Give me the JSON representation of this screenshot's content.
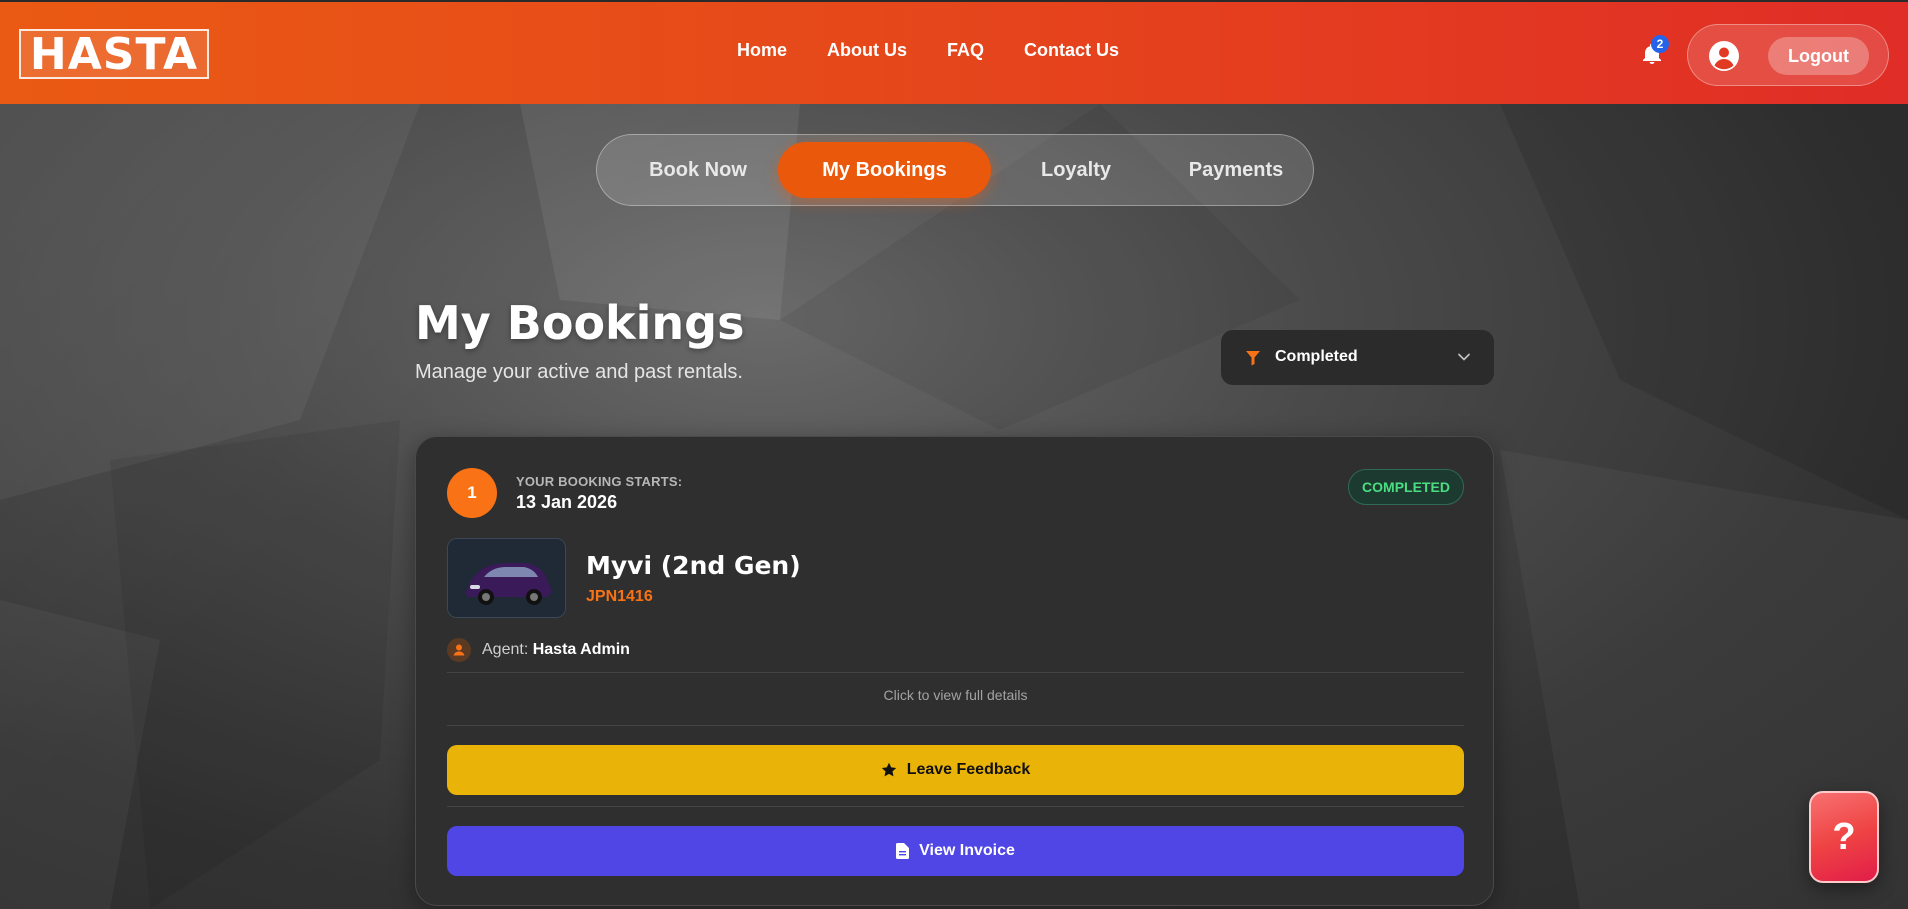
{
  "header": {
    "logo_text": "HASTA",
    "nav": [
      "Home",
      "About Us",
      "FAQ",
      "Contact Us"
    ],
    "notification_count": "2",
    "logout_label": "Logout"
  },
  "tabs": [
    {
      "label": "Book Now",
      "active": false
    },
    {
      "label": "My Bookings",
      "active": true
    },
    {
      "label": "Loyalty",
      "active": false
    },
    {
      "label": "Payments",
      "active": false
    }
  ],
  "page": {
    "title": "My Bookings",
    "subtitle": "Manage your active and past rentals.",
    "filter_value": "Completed"
  },
  "booking": {
    "number": "1",
    "starts_label": "YOUR BOOKING STARTS:",
    "starts_date": "13 Jan 2026",
    "status": "COMPLETED",
    "car_name": "Myvi (2nd Gen)",
    "plate": "JPN1416",
    "agent_label": "Agent:",
    "agent_name": "Hasta Admin",
    "details_hint": "Click to view full details",
    "feedback_label": "Leave Feedback",
    "invoice_label": "View Invoice"
  },
  "help_label": "?",
  "colors": {
    "brand_orange": "#ea580c",
    "status_green": "#4ade80",
    "feedback_yellow": "#eab308",
    "invoice_indigo": "#4f46e5"
  }
}
